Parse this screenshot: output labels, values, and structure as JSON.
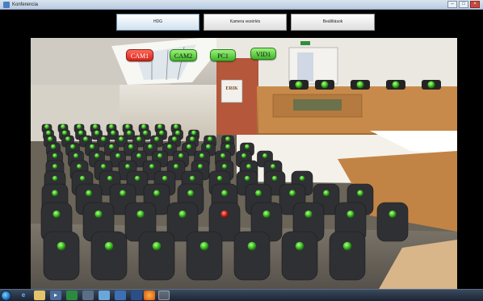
{
  "window": {
    "title": "Konferencia",
    "minimize_symbol": "–",
    "maximize_symbol": "□",
    "close_symbol": "×"
  },
  "menu": [
    {
      "label": "HDG",
      "active": true
    },
    {
      "label": "Kamera vezérlés",
      "active": false
    },
    {
      "label": "Beállítások",
      "active": false
    }
  ],
  "devices": [
    {
      "label": "CAM1",
      "state": "red"
    },
    {
      "label": "CAM2",
      "state": "green"
    },
    {
      "label": "PC1",
      "state": "green"
    },
    {
      "label": "VID1",
      "state": "green"
    }
  ],
  "podium_logo": "ERIK",
  "seat_indicators": {
    "total_rows": 13,
    "selected_seat_color": "#e02b20",
    "default_seat_color": "#47c82c"
  },
  "taskbar": {
    "items": [
      "start-orb",
      "ie-icon",
      "explorer-icon",
      "media-icon",
      "excel-icon",
      "network-icon",
      "app-icon",
      "word-icon",
      "firefox-icon",
      "camera-app-icon"
    ]
  },
  "colors": {
    "indicator_green": "#47c82c",
    "indicator_red": "#e02b20",
    "seat_dark": "#2f3033",
    "floor": "#6f6a5f"
  }
}
